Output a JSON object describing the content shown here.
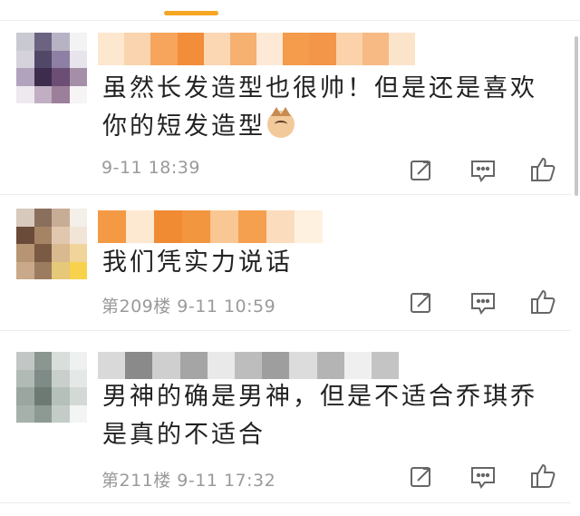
{
  "colors": {
    "accent": "#f5a623",
    "text": "#222222",
    "meta": "#9a9a9a"
  },
  "icons": [
    "share-icon",
    "reply-icon",
    "like-icon"
  ],
  "comments": [
    {
      "text_line1": "虽然长发造型也很帅！但是还是喜欢",
      "text_line2": "你的短发造型",
      "emoji": "cat-face",
      "meta": "9-11 18:39"
    },
    {
      "text_line1": "我们凭实力说话",
      "meta": "第209楼 9-11 10:59"
    },
    {
      "text_line1": "男神的确是男神，但是不适合乔琪乔",
      "text_line2": "是真的不适合",
      "meta": "第211楼 9-11 17:32"
    }
  ]
}
